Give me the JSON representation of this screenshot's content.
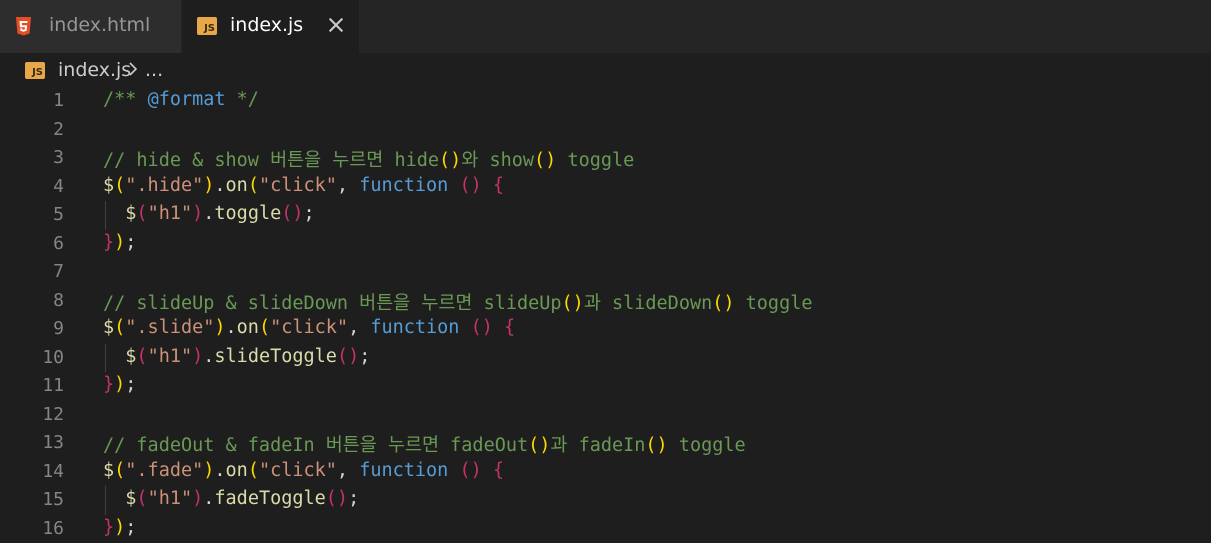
{
  "tabs": [
    {
      "label": "index.html",
      "icon": "html5-icon",
      "active": false
    },
    {
      "label": "index.js",
      "icon": "js-file-icon",
      "active": true
    }
  ],
  "breadcrumb": {
    "file": "index.js",
    "more": "..."
  },
  "colors": {
    "background": "#1e1e1e",
    "tabbar": "#252526",
    "comment": "#6a9955",
    "keyword": "#569cd6",
    "function": "#dcdcaa",
    "string": "#ce9178",
    "bracket_gold": "#ffd700",
    "bracket_red": "#c5326a",
    "line_number": "#858585"
  },
  "lines": [
    {
      "n": "1",
      "tokens": [
        [
          "c-comment",
          "/** "
        ],
        [
          "c-tag",
          "@format"
        ],
        [
          "c-comment",
          " */"
        ]
      ]
    },
    {
      "n": "2",
      "tokens": []
    },
    {
      "n": "3",
      "tokens": [
        [
          "c-comment",
          "// hide & show 버튼을 누르면 hide"
        ],
        [
          "c-p1",
          "()"
        ],
        [
          "c-comment",
          "와 show"
        ],
        [
          "c-p1",
          "()"
        ],
        [
          "c-comment",
          " toggle"
        ]
      ]
    },
    {
      "n": "4",
      "tokens": [
        [
          "c-dollar",
          "$"
        ],
        [
          "c-p1",
          "("
        ],
        [
          "c-str",
          "\".hide\""
        ],
        [
          "c-p1",
          ")"
        ],
        [
          "c-punc",
          "."
        ],
        [
          "c-fn",
          "on"
        ],
        [
          "c-p1",
          "("
        ],
        [
          "c-str",
          "\"click\""
        ],
        [
          "c-punc",
          ", "
        ],
        [
          "c-kw",
          "function"
        ],
        [
          "c-punc",
          " "
        ],
        [
          "c-p3",
          "()"
        ],
        [
          "c-punc",
          " "
        ],
        [
          "c-p3",
          "{"
        ]
      ]
    },
    {
      "n": "5",
      "tokens": [
        [
          "c-punc",
          "  "
        ],
        [
          "c-dollar",
          "$"
        ],
        [
          "c-p3",
          "("
        ],
        [
          "c-str",
          "\"h1\""
        ],
        [
          "c-p3",
          ")"
        ],
        [
          "c-punc",
          "."
        ],
        [
          "c-fn",
          "toggle"
        ],
        [
          "c-p3",
          "()"
        ],
        [
          "c-punc",
          ";"
        ]
      ]
    },
    {
      "n": "6",
      "tokens": [
        [
          "c-p3",
          "}"
        ],
        [
          "c-p1",
          ")"
        ],
        [
          "c-punc",
          ";"
        ]
      ]
    },
    {
      "n": "7",
      "tokens": []
    },
    {
      "n": "8",
      "tokens": [
        [
          "c-comment",
          "// slideUp & slideDown 버튼을 누르면 slideUp"
        ],
        [
          "c-p1",
          "()"
        ],
        [
          "c-comment",
          "과 slideDown"
        ],
        [
          "c-p1",
          "()"
        ],
        [
          "c-comment",
          " toggle"
        ]
      ]
    },
    {
      "n": "9",
      "tokens": [
        [
          "c-dollar",
          "$"
        ],
        [
          "c-p1",
          "("
        ],
        [
          "c-str",
          "\".slide\""
        ],
        [
          "c-p1",
          ")"
        ],
        [
          "c-punc",
          "."
        ],
        [
          "c-fn",
          "on"
        ],
        [
          "c-p1",
          "("
        ],
        [
          "c-str",
          "\"click\""
        ],
        [
          "c-punc",
          ", "
        ],
        [
          "c-kw",
          "function"
        ],
        [
          "c-punc",
          " "
        ],
        [
          "c-p3",
          "()"
        ],
        [
          "c-punc",
          " "
        ],
        [
          "c-p3",
          "{"
        ]
      ]
    },
    {
      "n": "10",
      "tokens": [
        [
          "c-punc",
          "  "
        ],
        [
          "c-dollar",
          "$"
        ],
        [
          "c-p3",
          "("
        ],
        [
          "c-str",
          "\"h1\""
        ],
        [
          "c-p3",
          ")"
        ],
        [
          "c-punc",
          "."
        ],
        [
          "c-fn",
          "slideToggle"
        ],
        [
          "c-p3",
          "()"
        ],
        [
          "c-punc",
          ";"
        ]
      ]
    },
    {
      "n": "11",
      "tokens": [
        [
          "c-p3",
          "}"
        ],
        [
          "c-p1",
          ")"
        ],
        [
          "c-punc",
          ";"
        ]
      ]
    },
    {
      "n": "12",
      "tokens": []
    },
    {
      "n": "13",
      "tokens": [
        [
          "c-comment",
          "// fadeOut & fadeIn 버튼을 누르면 fadeOut"
        ],
        [
          "c-p1",
          "()"
        ],
        [
          "c-comment",
          "과 fadeIn"
        ],
        [
          "c-p1",
          "()"
        ],
        [
          "c-comment",
          " toggle"
        ]
      ]
    },
    {
      "n": "14",
      "tokens": [
        [
          "c-dollar",
          "$"
        ],
        [
          "c-p1",
          "("
        ],
        [
          "c-str",
          "\".fade\""
        ],
        [
          "c-p1",
          ")"
        ],
        [
          "c-punc",
          "."
        ],
        [
          "c-fn",
          "on"
        ],
        [
          "c-p1",
          "("
        ],
        [
          "c-str",
          "\"click\""
        ],
        [
          "c-punc",
          ", "
        ],
        [
          "c-kw",
          "function"
        ],
        [
          "c-punc",
          " "
        ],
        [
          "c-p3",
          "()"
        ],
        [
          "c-punc",
          " "
        ],
        [
          "c-p3",
          "{"
        ]
      ]
    },
    {
      "n": "15",
      "tokens": [
        [
          "c-punc",
          "  "
        ],
        [
          "c-dollar",
          "$"
        ],
        [
          "c-p3",
          "("
        ],
        [
          "c-str",
          "\"h1\""
        ],
        [
          "c-p3",
          ")"
        ],
        [
          "c-punc",
          "."
        ],
        [
          "c-fn",
          "fadeToggle"
        ],
        [
          "c-p3",
          "()"
        ],
        [
          "c-punc",
          ";"
        ]
      ]
    },
    {
      "n": "16",
      "tokens": [
        [
          "c-p3",
          "}"
        ],
        [
          "c-p1",
          ")"
        ],
        [
          "c-punc",
          ";"
        ]
      ]
    }
  ]
}
